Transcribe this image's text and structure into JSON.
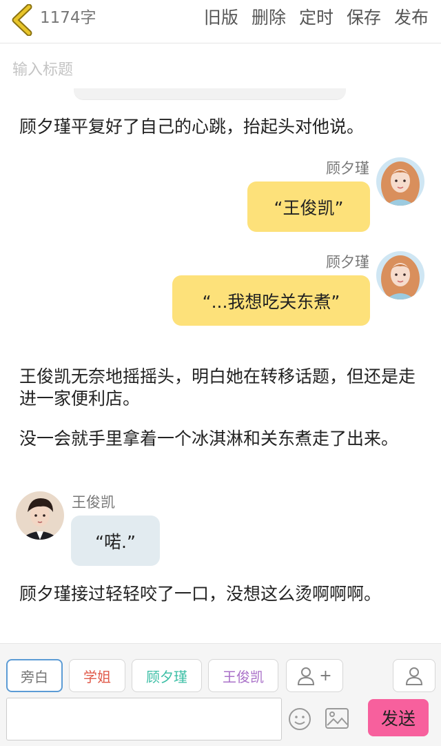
{
  "header": {
    "word_count": "1174字",
    "actions": [
      "旧版",
      "删除",
      "定时",
      "保存",
      "发布"
    ]
  },
  "title": {
    "placeholder": "输入标题",
    "value": ""
  },
  "content": {
    "narration_1": "顾夕瑾平复好了自己的心跳，抬起头对他说。",
    "messages": [
      {
        "sender": "顾夕瑾",
        "text": "“王俊凯”"
      },
      {
        "sender": "顾夕瑾",
        "text": "“...我想吃关东煮”"
      },
      {
        "sender": "王俊凯",
        "text": "“喏.”"
      }
    ],
    "narration_2": "王俊凯无奈地摇摇头，明白她在转移话题，但还是走进一家便利店。",
    "narration_3": "没一会就手里拿着一个冰淇淋和关东煮走了出来。",
    "narration_4": "顾夕瑾接过轻轻咬了一口，没想这么烫啊啊啊。"
  },
  "roles": [
    {
      "label": "旁白",
      "color": "#777777"
    },
    {
      "label": "学姐",
      "color": "#e05a4a"
    },
    {
      "label": "顾夕瑾",
      "color": "#3dbfa6"
    },
    {
      "label": "王俊凯",
      "color": "#a970c8"
    }
  ],
  "add_role_label": "+",
  "composer": {
    "placeholder": "",
    "send_label": "发送"
  },
  "colors": {
    "accent_send": "#f7609d",
    "bubble_self": "#fde17a",
    "bubble_other": "#e2ebf0",
    "back_arrow": "#d8b51e"
  },
  "icons": [
    "back-chevron-icon",
    "user-add-icon",
    "user-icon",
    "emoji-icon",
    "image-icon"
  ]
}
